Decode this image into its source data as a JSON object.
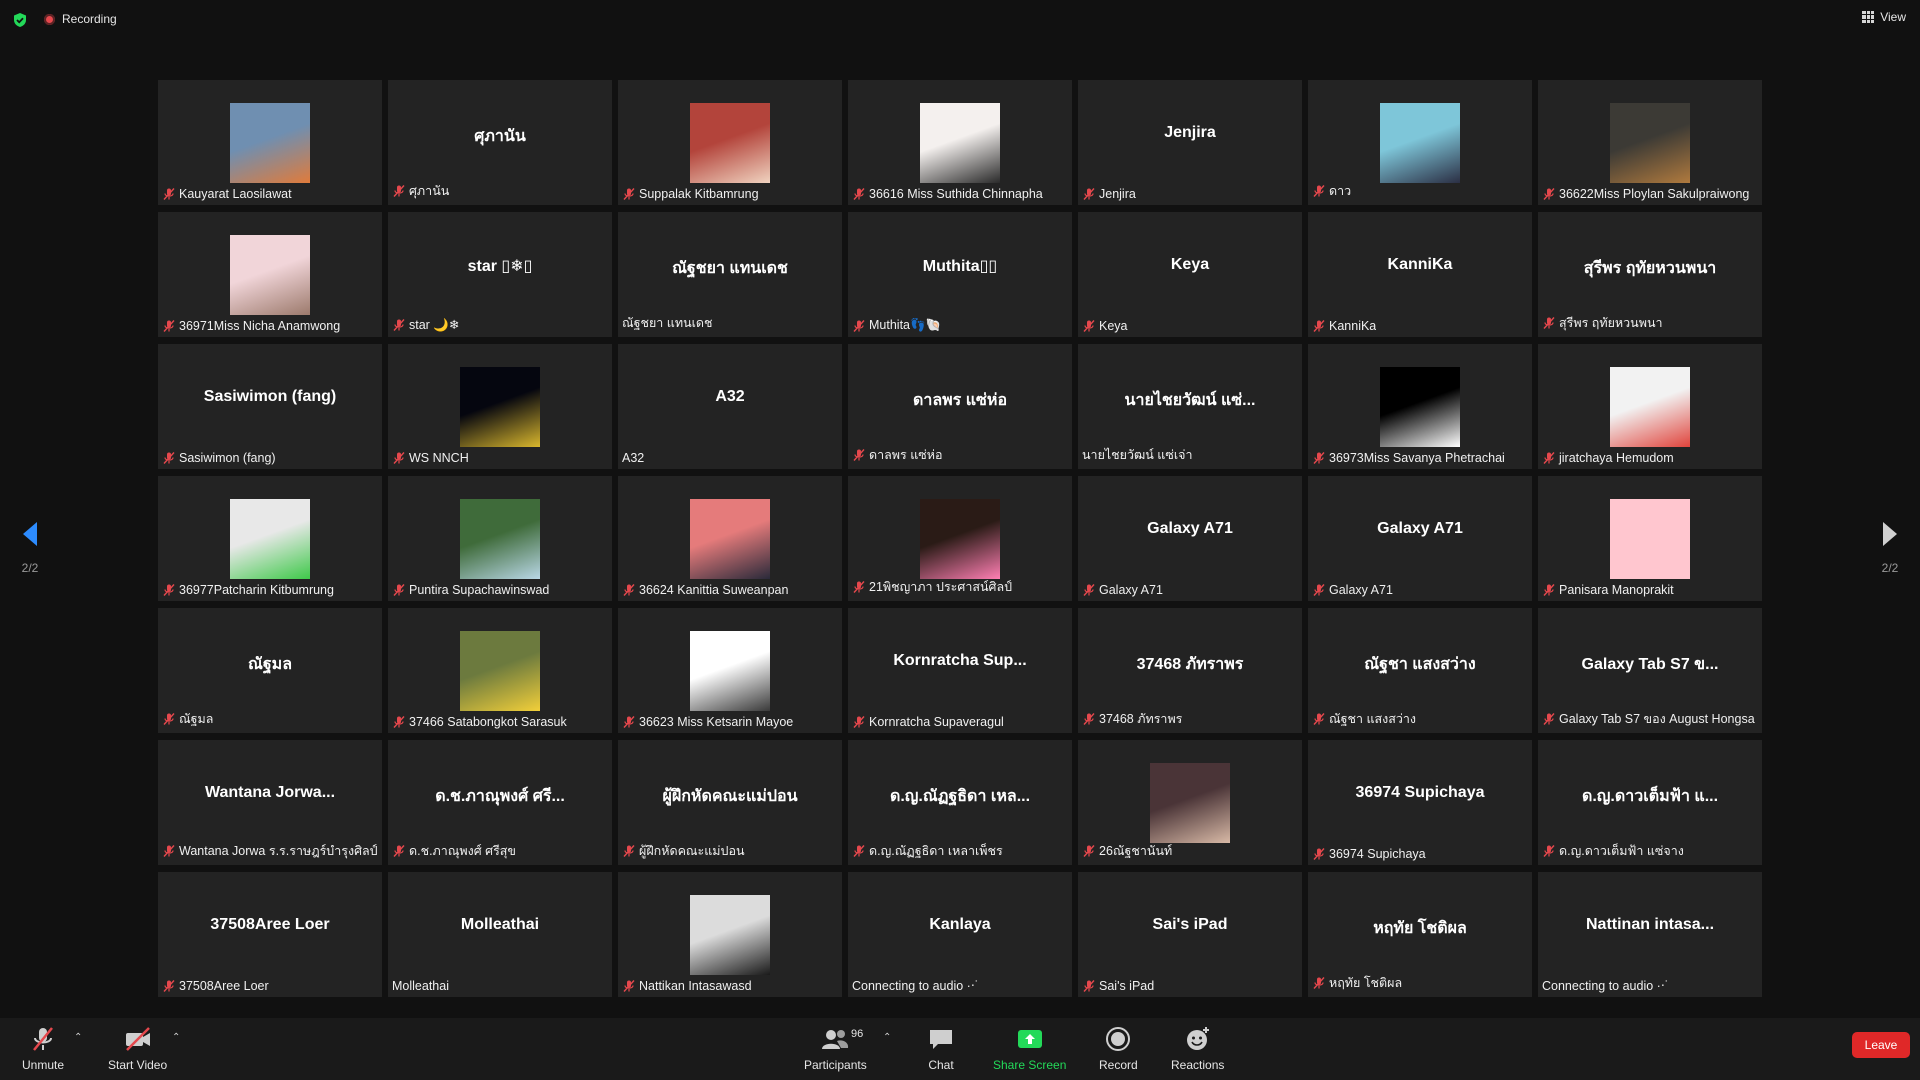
{
  "topbar": {
    "recording_label": "Recording",
    "view_label": "View"
  },
  "pager": {
    "page": "2/2"
  },
  "tiles": [
    {
      "center": "",
      "label": "Kauyarat Laosilawat",
      "muted": true,
      "avatar": "photo",
      "avatar_colors": [
        "#6f8fb1",
        "#e07b3b"
      ]
    },
    {
      "center": "ศุภานัน",
      "label": "ศุภานัน",
      "muted": true
    },
    {
      "center": "",
      "label": "Suppalak Kitbamrung",
      "muted": true,
      "avatar": "photo",
      "avatar_colors": [
        "#b3443b",
        "#f0d3c0"
      ]
    },
    {
      "center": "",
      "label": "36616 Miss Suthida Chinnapha",
      "muted": true,
      "avatar": "photo",
      "avatar_colors": [
        "#f4f0ee",
        "#2a2a2a"
      ]
    },
    {
      "center": "Jenjira",
      "label": "Jenjira",
      "muted": true
    },
    {
      "center": "",
      "label": "ดาว",
      "muted": true,
      "avatar": "photo",
      "avatar_colors": [
        "#7ec6d9",
        "#2b2f44"
      ]
    },
    {
      "center": "",
      "label": "36622Miss Ploylan Sakulpraiwong",
      "muted": true,
      "avatar": "photo",
      "avatar_colors": [
        "#3c3a35",
        "#b07a3e"
      ]
    },
    {
      "center": "",
      "label": "36971Miss Nicha Anamwong",
      "muted": true,
      "avatar": "photo",
      "avatar_colors": [
        "#f1d5d9",
        "#9c7a6c"
      ]
    },
    {
      "center": "star ▯❄▯",
      "label": "star 🌙❄",
      "muted": true
    },
    {
      "center": "ณัฐชยา แทนเดช",
      "label": "ณัฐชยา แทนเดช",
      "muted": false
    },
    {
      "center": "Muthita▯▯",
      "label": "Muthita👣🐚",
      "muted": true
    },
    {
      "center": "Keya",
      "label": "Keya",
      "muted": true
    },
    {
      "center": "KanniKa",
      "label": "KanniKa",
      "muted": true
    },
    {
      "center": "สุรีพร ฤทัยหวนพนา",
      "label": "สุรีพร ฤทัยหวนพนา",
      "muted": true
    },
    {
      "center": "Sasiwimon (fang)",
      "label": "Sasiwimon (fang)",
      "muted": true
    },
    {
      "center": "",
      "label": "WS NNCH",
      "muted": true,
      "avatar": "photo",
      "avatar_colors": [
        "#05060f",
        "#d9b72d"
      ]
    },
    {
      "center": "A32",
      "label": "A32",
      "muted": false
    },
    {
      "center": "ดาลพร แซ่ห่อ",
      "label": "ดาลพร แซ่ห่อ",
      "muted": true
    },
    {
      "center": "นายไชยวัฒน์ แซ่...",
      "label": "นายไชยวัฒน์ แซ่เจ่า",
      "muted": false
    },
    {
      "center": "",
      "label": "36973Miss Savanya Phetrachai",
      "muted": true,
      "avatar": "photo",
      "avatar_colors": [
        "#000000",
        "#ffffff"
      ]
    },
    {
      "center": "",
      "label": "jiratchaya Hemudom",
      "muted": true,
      "avatar": "photo",
      "avatar_colors": [
        "#f2f2f2",
        "#e0443c"
      ]
    },
    {
      "center": "",
      "label": "36977Patcharin Kitbumrung",
      "muted": true,
      "avatar": "photo",
      "avatar_colors": [
        "#e8e8e8",
        "#3fc94a"
      ]
    },
    {
      "center": "",
      "label": "Puntira Supachawinswad",
      "muted": true,
      "avatar": "photo",
      "avatar_colors": [
        "#3f6b3a",
        "#b9d7e6"
      ]
    },
    {
      "center": "",
      "label": "36624 Kanittia Suweanpan",
      "muted": true,
      "avatar": "photo",
      "avatar_colors": [
        "#e57b7b",
        "#2a2a3a"
      ]
    },
    {
      "center": "",
      "label": "21พิชญาภา ประศาสน์ศิลป์",
      "muted": true,
      "avatar": "photo",
      "avatar_colors": [
        "#2a1b16",
        "#ff7fb3"
      ]
    },
    {
      "center": "Galaxy A71",
      "label": "Galaxy A71",
      "muted": true
    },
    {
      "center": "Galaxy A71",
      "label": "Galaxy A71",
      "muted": true
    },
    {
      "center": "",
      "label": "Panisara Manoprakit",
      "muted": true,
      "avatar": "photo",
      "avatar_colors": [
        "#ffc6cf",
        "#ffc6cf"
      ]
    },
    {
      "center": "ณัฐมล",
      "label": "ณัฐมล",
      "muted": true
    },
    {
      "center": "",
      "label": "37466 Satabongkot Sarasuk",
      "muted": true,
      "avatar": "photo",
      "avatar_colors": [
        "#6c7a3e",
        "#f2cf3a"
      ]
    },
    {
      "center": "",
      "label": "36623 Miss Ketsarin Mayoe",
      "muted": true,
      "avatar": "photo",
      "avatar_colors": [
        "#ffffff",
        "#3a3a3a"
      ]
    },
    {
      "center": "Kornratcha  Sup...",
      "label": "Kornratcha Supaveragul",
      "muted": true
    },
    {
      "center": "37468 ภัทราพร",
      "label": "37468 ภัทราพร",
      "muted": true
    },
    {
      "center": "ณัฐชา     แสงสว่าง",
      "label": "ณัฐชา     แสงสว่าง",
      "muted": true
    },
    {
      "center": "Galaxy Tab S7 ข...",
      "label": "Galaxy Tab S7 ของ August Hongsa",
      "muted": true
    },
    {
      "center": "Wantana  Jorwa...",
      "label": "Wantana Jorwa ร.ร.ราษฎร์บำรุงศิลป์",
      "muted": true
    },
    {
      "center": "ด.ช.ภาณุพงศ์  ศรี...",
      "label": "ด.ช.ภาณุพงศ์ ศรีสุข",
      "muted": true
    },
    {
      "center": "ผู้ฝึกหัดคณะแม่ปอน",
      "label": "ผู้ฝึกหัดคณะแม่ปอน",
      "muted": true
    },
    {
      "center": "ด.ญ.ณัฏฐธิดา เหล...",
      "label": "ด.ญ.ณัฏฐธิดา เหลาเพ็ชร",
      "muted": true
    },
    {
      "center": "",
      "label": "26ณัฐชานันท์",
      "muted": true,
      "avatar": "photo",
      "avatar_colors": [
        "#4a3437",
        "#d8b9a6"
      ]
    },
    {
      "center": "36974 Supichaya",
      "label": "36974 Supichaya",
      "muted": true
    },
    {
      "center": "ด.ญ.ดาวเต็มฟ้า แ...",
      "label": "ด.ญ.ดาวเต็มฟ้า แซ่จาง",
      "muted": true
    },
    {
      "center": "37508Aree Loer",
      "label": "37508Aree Loer",
      "muted": true
    },
    {
      "center": "Molleathai",
      "label": "Molleathai",
      "muted": false
    },
    {
      "center": "",
      "label": "Nattikan Intasawasd",
      "muted": true,
      "avatar": "photo",
      "avatar_colors": [
        "#dcdcdc",
        "#1a1a1a"
      ]
    },
    {
      "center": "Kanlaya",
      "label": "Connecting to audio ·‧˙",
      "muted": false
    },
    {
      "center": "Sai's iPad",
      "label": "Sai's iPad",
      "muted": true
    },
    {
      "center": "หฤทัย โชติผล",
      "label": "หฤทัย โชติผล",
      "muted": true
    },
    {
      "center": "Nattinan  intasa...",
      "label": "Connecting to audio ·‧˙",
      "muted": false
    }
  ],
  "toolbar": {
    "unmute": "Unmute",
    "start_video": "Start Video",
    "participants": "Participants",
    "participants_count": "96",
    "chat": "Chat",
    "share_screen": "Share Screen",
    "record": "Record",
    "reactions": "Reactions",
    "leave": "Leave"
  },
  "colors": {
    "share_green": "#23d959",
    "leave_red": "#e02828",
    "muted_red": "#e5484d",
    "arrow_blue": "#2d8cff"
  }
}
